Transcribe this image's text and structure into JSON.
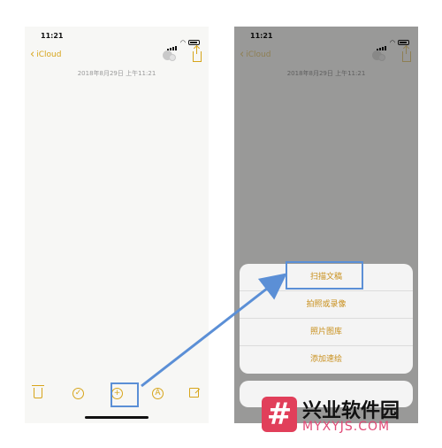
{
  "status_bar": {
    "time": "11:21"
  },
  "nav": {
    "back_label": "iCloud"
  },
  "note": {
    "date": "2018年8月29日 上午11:21"
  },
  "toolbar": {
    "icons": [
      "trash-icon",
      "checklist-icon",
      "add-icon",
      "markup-icon",
      "compose-icon"
    ],
    "add_glyph": "+",
    "pen_glyph": "A"
  },
  "action_sheet": {
    "options": [
      "扫描文稿",
      "拍照或录像",
      "照片图库",
      "添加速绘"
    ]
  },
  "watermark": {
    "glyph": "#",
    "title": "兴业软件园",
    "url": "MYXYJS.COM"
  },
  "colors": {
    "accent": "#d7a51b",
    "highlight": "#5b8fd6",
    "watermark_red": "#e13f5a"
  }
}
